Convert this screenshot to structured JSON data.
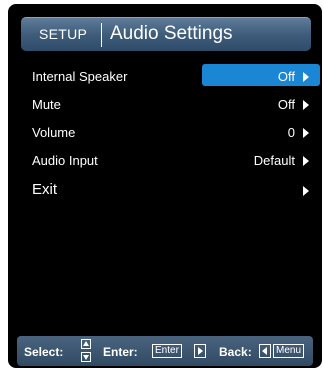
{
  "header": {
    "section": "SETUP",
    "title": "Audio Settings"
  },
  "menu": {
    "items": [
      {
        "label": "Internal Speaker",
        "value": "Off",
        "selected": true
      },
      {
        "label": "Mute",
        "value": "Off",
        "selected": false
      },
      {
        "label": "Volume",
        "value": "0",
        "selected": false
      },
      {
        "label": "Audio Input",
        "value": "Default",
        "selected": false
      },
      {
        "label": "Exit",
        "value": "",
        "selected": false
      }
    ]
  },
  "footer": {
    "select_label": "Select:",
    "enter_label": "Enter:",
    "enter_key": "Enter",
    "back_label": "Back:",
    "menu_key": "Menu"
  },
  "colors": {
    "background": "#000000",
    "highlight": "#1a86d4",
    "title_bar": "#4a6886",
    "text": "#ffffff"
  }
}
